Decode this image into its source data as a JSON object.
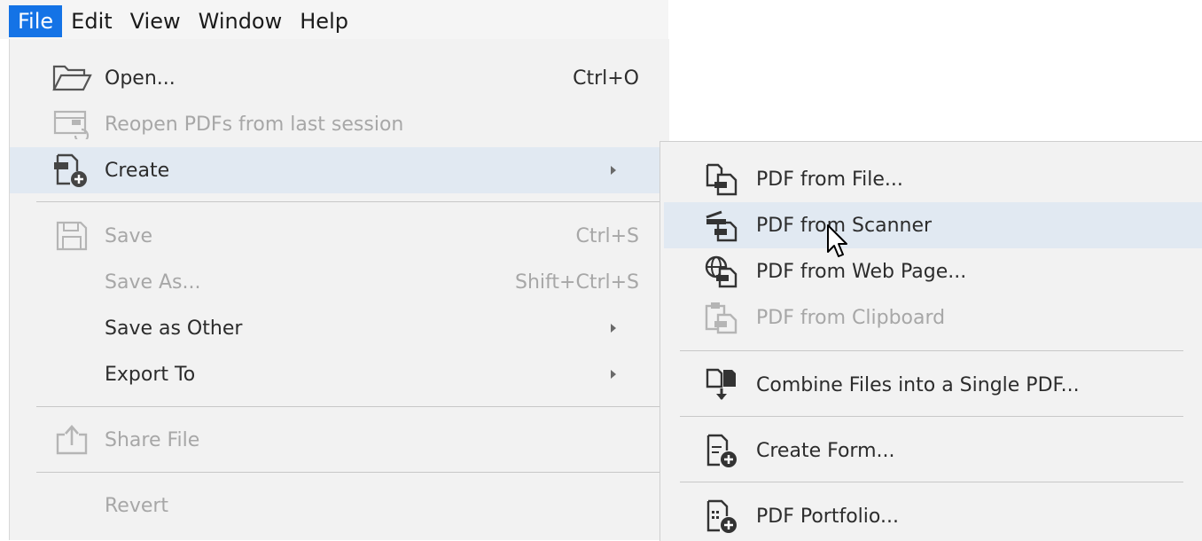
{
  "menubar": {
    "items": [
      "File",
      "Edit",
      "View",
      "Window",
      "Help"
    ]
  },
  "file_menu": {
    "open": {
      "label": "Open...",
      "shortcut": "Ctrl+O"
    },
    "reopen": {
      "label": "Reopen PDFs from last session"
    },
    "create": {
      "label": "Create"
    },
    "save": {
      "label": "Save",
      "shortcut": "Ctrl+S"
    },
    "save_as": {
      "label": "Save As...",
      "shortcut": "Shift+Ctrl+S"
    },
    "save_as_other": {
      "label": "Save as Other"
    },
    "export_to": {
      "label": "Export To"
    },
    "share_file": {
      "label": "Share File"
    },
    "revert": {
      "label": "Revert"
    }
  },
  "create_submenu": {
    "pdf_from_file": {
      "label": "PDF from File..."
    },
    "pdf_from_scanner": {
      "label": "PDF from Scanner"
    },
    "pdf_from_web_page": {
      "label": "PDF from Web Page..."
    },
    "pdf_from_clipboard": {
      "label": "PDF from Clipboard"
    },
    "combine_files": {
      "label": "Combine Files into a Single PDF..."
    },
    "create_form": {
      "label": "Create Form..."
    },
    "pdf_portfolio": {
      "label": "PDF Portfolio..."
    }
  },
  "colors": {
    "accent": "#1473e6",
    "highlight": "#e1e9f2",
    "disabled_text": "#a7a7a7"
  }
}
